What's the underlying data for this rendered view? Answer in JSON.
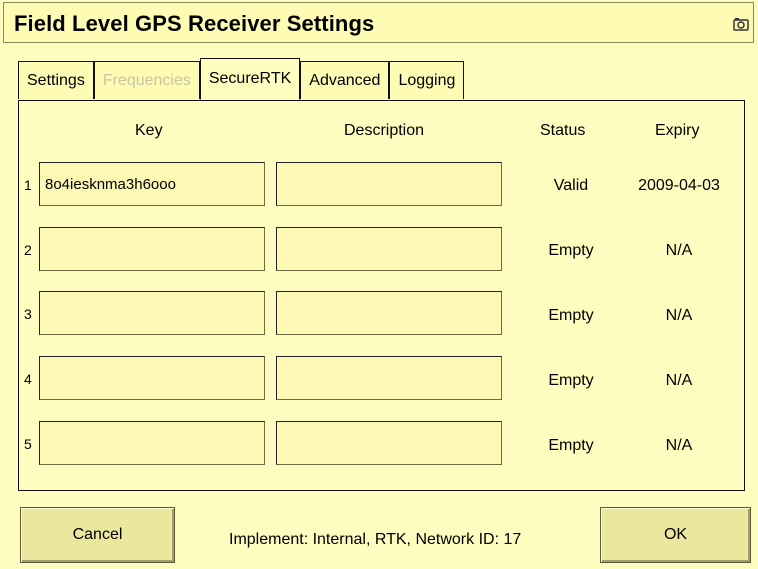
{
  "window": {
    "title": "Field Level GPS Receiver Settings"
  },
  "tabs": [
    {
      "label": "Settings",
      "state": "normal"
    },
    {
      "label": "Frequencies",
      "state": "disabled"
    },
    {
      "label": "SecureRTK",
      "state": "active"
    },
    {
      "label": "Advanced",
      "state": "normal"
    },
    {
      "label": "Logging",
      "state": "normal"
    }
  ],
  "table": {
    "headers": {
      "key": "Key",
      "description": "Description",
      "status": "Status",
      "expiry": "Expiry"
    },
    "rows": [
      {
        "num": "1",
        "key": "8o4iesknma3h6ooo",
        "description": "",
        "status": "Valid",
        "expiry": "2009-04-03"
      },
      {
        "num": "2",
        "key": "",
        "description": "",
        "status": "Empty",
        "expiry": "N/A"
      },
      {
        "num": "3",
        "key": "",
        "description": "",
        "status": "Empty",
        "expiry": "N/A"
      },
      {
        "num": "4",
        "key": "",
        "description": "",
        "status": "Empty",
        "expiry": "N/A"
      },
      {
        "num": "5",
        "key": "",
        "description": "",
        "status": "Empty",
        "expiry": "N/A"
      }
    ]
  },
  "footer": {
    "cancel_label": "Cancel",
    "ok_label": "OK",
    "implement_text": "Implement: Internal, RTK, Network ID: 17"
  },
  "icons": {
    "title_right": "camera-icon"
  },
  "colors": {
    "background": "#fffcc0",
    "button": "#ebe79e",
    "disabled_text": "#c9c5a0"
  }
}
